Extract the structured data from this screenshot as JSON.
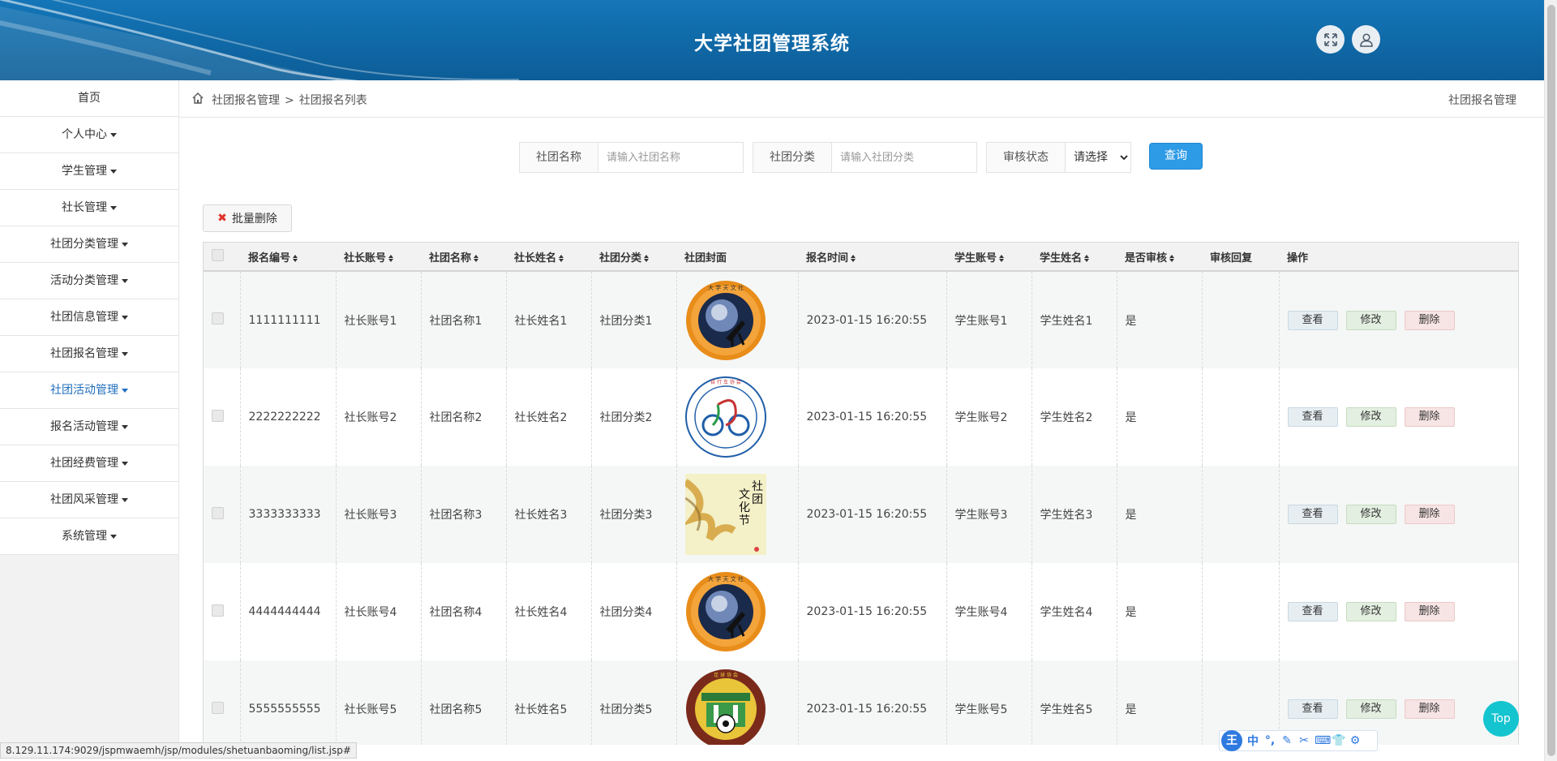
{
  "header": {
    "title": "大学社团管理系统"
  },
  "sidebar": {
    "items": [
      {
        "label": "首页",
        "caret": false
      },
      {
        "label": "个人中心",
        "caret": true
      },
      {
        "label": "学生管理",
        "caret": true
      },
      {
        "label": "社长管理",
        "caret": true
      },
      {
        "label": "社团分类管理",
        "caret": true
      },
      {
        "label": "活动分类管理",
        "caret": true
      },
      {
        "label": "社团信息管理",
        "caret": true
      },
      {
        "label": "社团报名管理",
        "caret": true
      },
      {
        "label": "社团活动管理",
        "caret": true
      },
      {
        "label": "报名活动管理",
        "caret": true
      },
      {
        "label": "社团经费管理",
        "caret": true
      },
      {
        "label": "社团风采管理",
        "caret": true
      },
      {
        "label": "系统管理",
        "caret": true
      }
    ]
  },
  "breadcrumb": {
    "level1": "社团报名管理",
    "separator": ">",
    "level2": "社团报名列表",
    "right_title": "社团报名管理"
  },
  "search": {
    "club_name_label": "社团名称",
    "club_name_placeholder": "请输入社团名称",
    "club_category_label": "社团分类",
    "club_category_placeholder": "请输入社团分类",
    "review_status_label": "审核状态",
    "review_status_value": "请选择",
    "query_button": "查询"
  },
  "bulk_delete": "批量删除",
  "table": {
    "headers": [
      "报名编号",
      "社长账号",
      "社团名称",
      "社长姓名",
      "社团分类",
      "社团封面",
      "报名时间",
      "学生账号",
      "学生姓名",
      "是否审核",
      "审核回复",
      "操作"
    ],
    "rows": [
      {
        "id": "1111111111",
        "president_account": "社长账号1",
        "club_name": "社团名称1",
        "president_name": "社长姓名1",
        "category": "社团分类1",
        "cover": "astronomy-society-logo",
        "time": "2023-01-15 16:20:55",
        "student_account": "学生账号1",
        "student_name": "学生姓名1",
        "reviewed": "是",
        "reply": ""
      },
      {
        "id": "2222222222",
        "president_account": "社长账号2",
        "club_name": "社团名称2",
        "president_name": "社长姓名2",
        "category": "社团分类2",
        "cover": "cycling-club-logo",
        "time": "2023-01-15 16:20:55",
        "student_account": "学生账号2",
        "student_name": "学生姓名2",
        "reviewed": "是",
        "reply": ""
      },
      {
        "id": "3333333333",
        "president_account": "社长账号3",
        "club_name": "社团名称3",
        "president_name": "社长姓名3",
        "category": "社团分类3",
        "cover": "culture-festival-poster",
        "time": "2023-01-15 16:20:55",
        "student_account": "学生账号3",
        "student_name": "学生姓名3",
        "reviewed": "是",
        "reply": ""
      },
      {
        "id": "4444444444",
        "president_account": "社长账号4",
        "club_name": "社团名称4",
        "president_name": "社长姓名4",
        "category": "社团分类4",
        "cover": "astronomy-society-logo",
        "time": "2023-01-15 16:20:55",
        "student_account": "学生账号4",
        "student_name": "学生姓名4",
        "reviewed": "是",
        "reply": ""
      },
      {
        "id": "5555555555",
        "president_account": "社长账号5",
        "club_name": "社团名称5",
        "president_name": "社长姓名5",
        "category": "社团分类5",
        "cover": "football-club-logo",
        "time": "2023-01-15 16:20:55",
        "student_account": "学生账号5",
        "student_name": "学生姓名5",
        "reviewed": "是",
        "reply": ""
      }
    ],
    "actions": {
      "view": "查看",
      "edit": "修改",
      "delete": "删除"
    }
  },
  "status_bar": "8.129.11.174:9029/jspmwaemh/jsp/modules/shetuanbaoming/list.jsp#",
  "top_button": "Top",
  "ime_toolbar": {
    "logo": "王",
    "mode": "中"
  },
  "colors": {
    "header": "#0f66a3",
    "primary_button": "#2e9be6",
    "top_button": "#14c4cf"
  }
}
